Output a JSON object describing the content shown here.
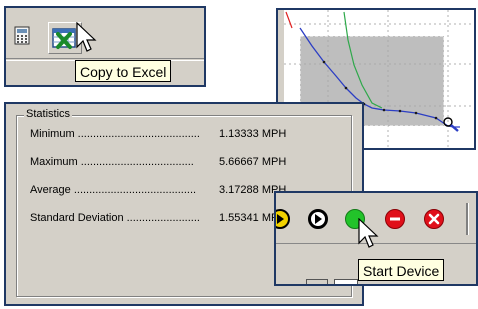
{
  "toolbar_excel": {
    "calculator_icon": "calculator-icon",
    "excel_icon": "excel-export-icon",
    "tooltip": "Copy to Excel"
  },
  "chart": {
    "type": "line",
    "grid": "dotted",
    "selection": "zoom-rectangle"
  },
  "statistics": {
    "title": "Statistics",
    "rows": [
      {
        "label": "Minimum ........................................",
        "value": "1.13333 MPH"
      },
      {
        "label": "Maximum .....................................",
        "value": "5.66667 MPH"
      },
      {
        "label": "Average ........................................",
        "value": "3.17288 MPH"
      },
      {
        "label": "Standard Deviation ........................",
        "value": "1.55341 MPH"
      }
    ]
  },
  "device_toolbar": {
    "buttons": [
      "yellow-arrow-icon",
      "play-icon",
      "start-device-icon",
      "stop-device-icon",
      "cancel-icon"
    ],
    "tooltip": "Start Device"
  },
  "colors": {
    "frame": "#1f3864",
    "panel": "#d4d0c8",
    "tooltip_bg": "#ffffe1",
    "start_green": "#22c32a",
    "stop_red": "#e0101a"
  }
}
